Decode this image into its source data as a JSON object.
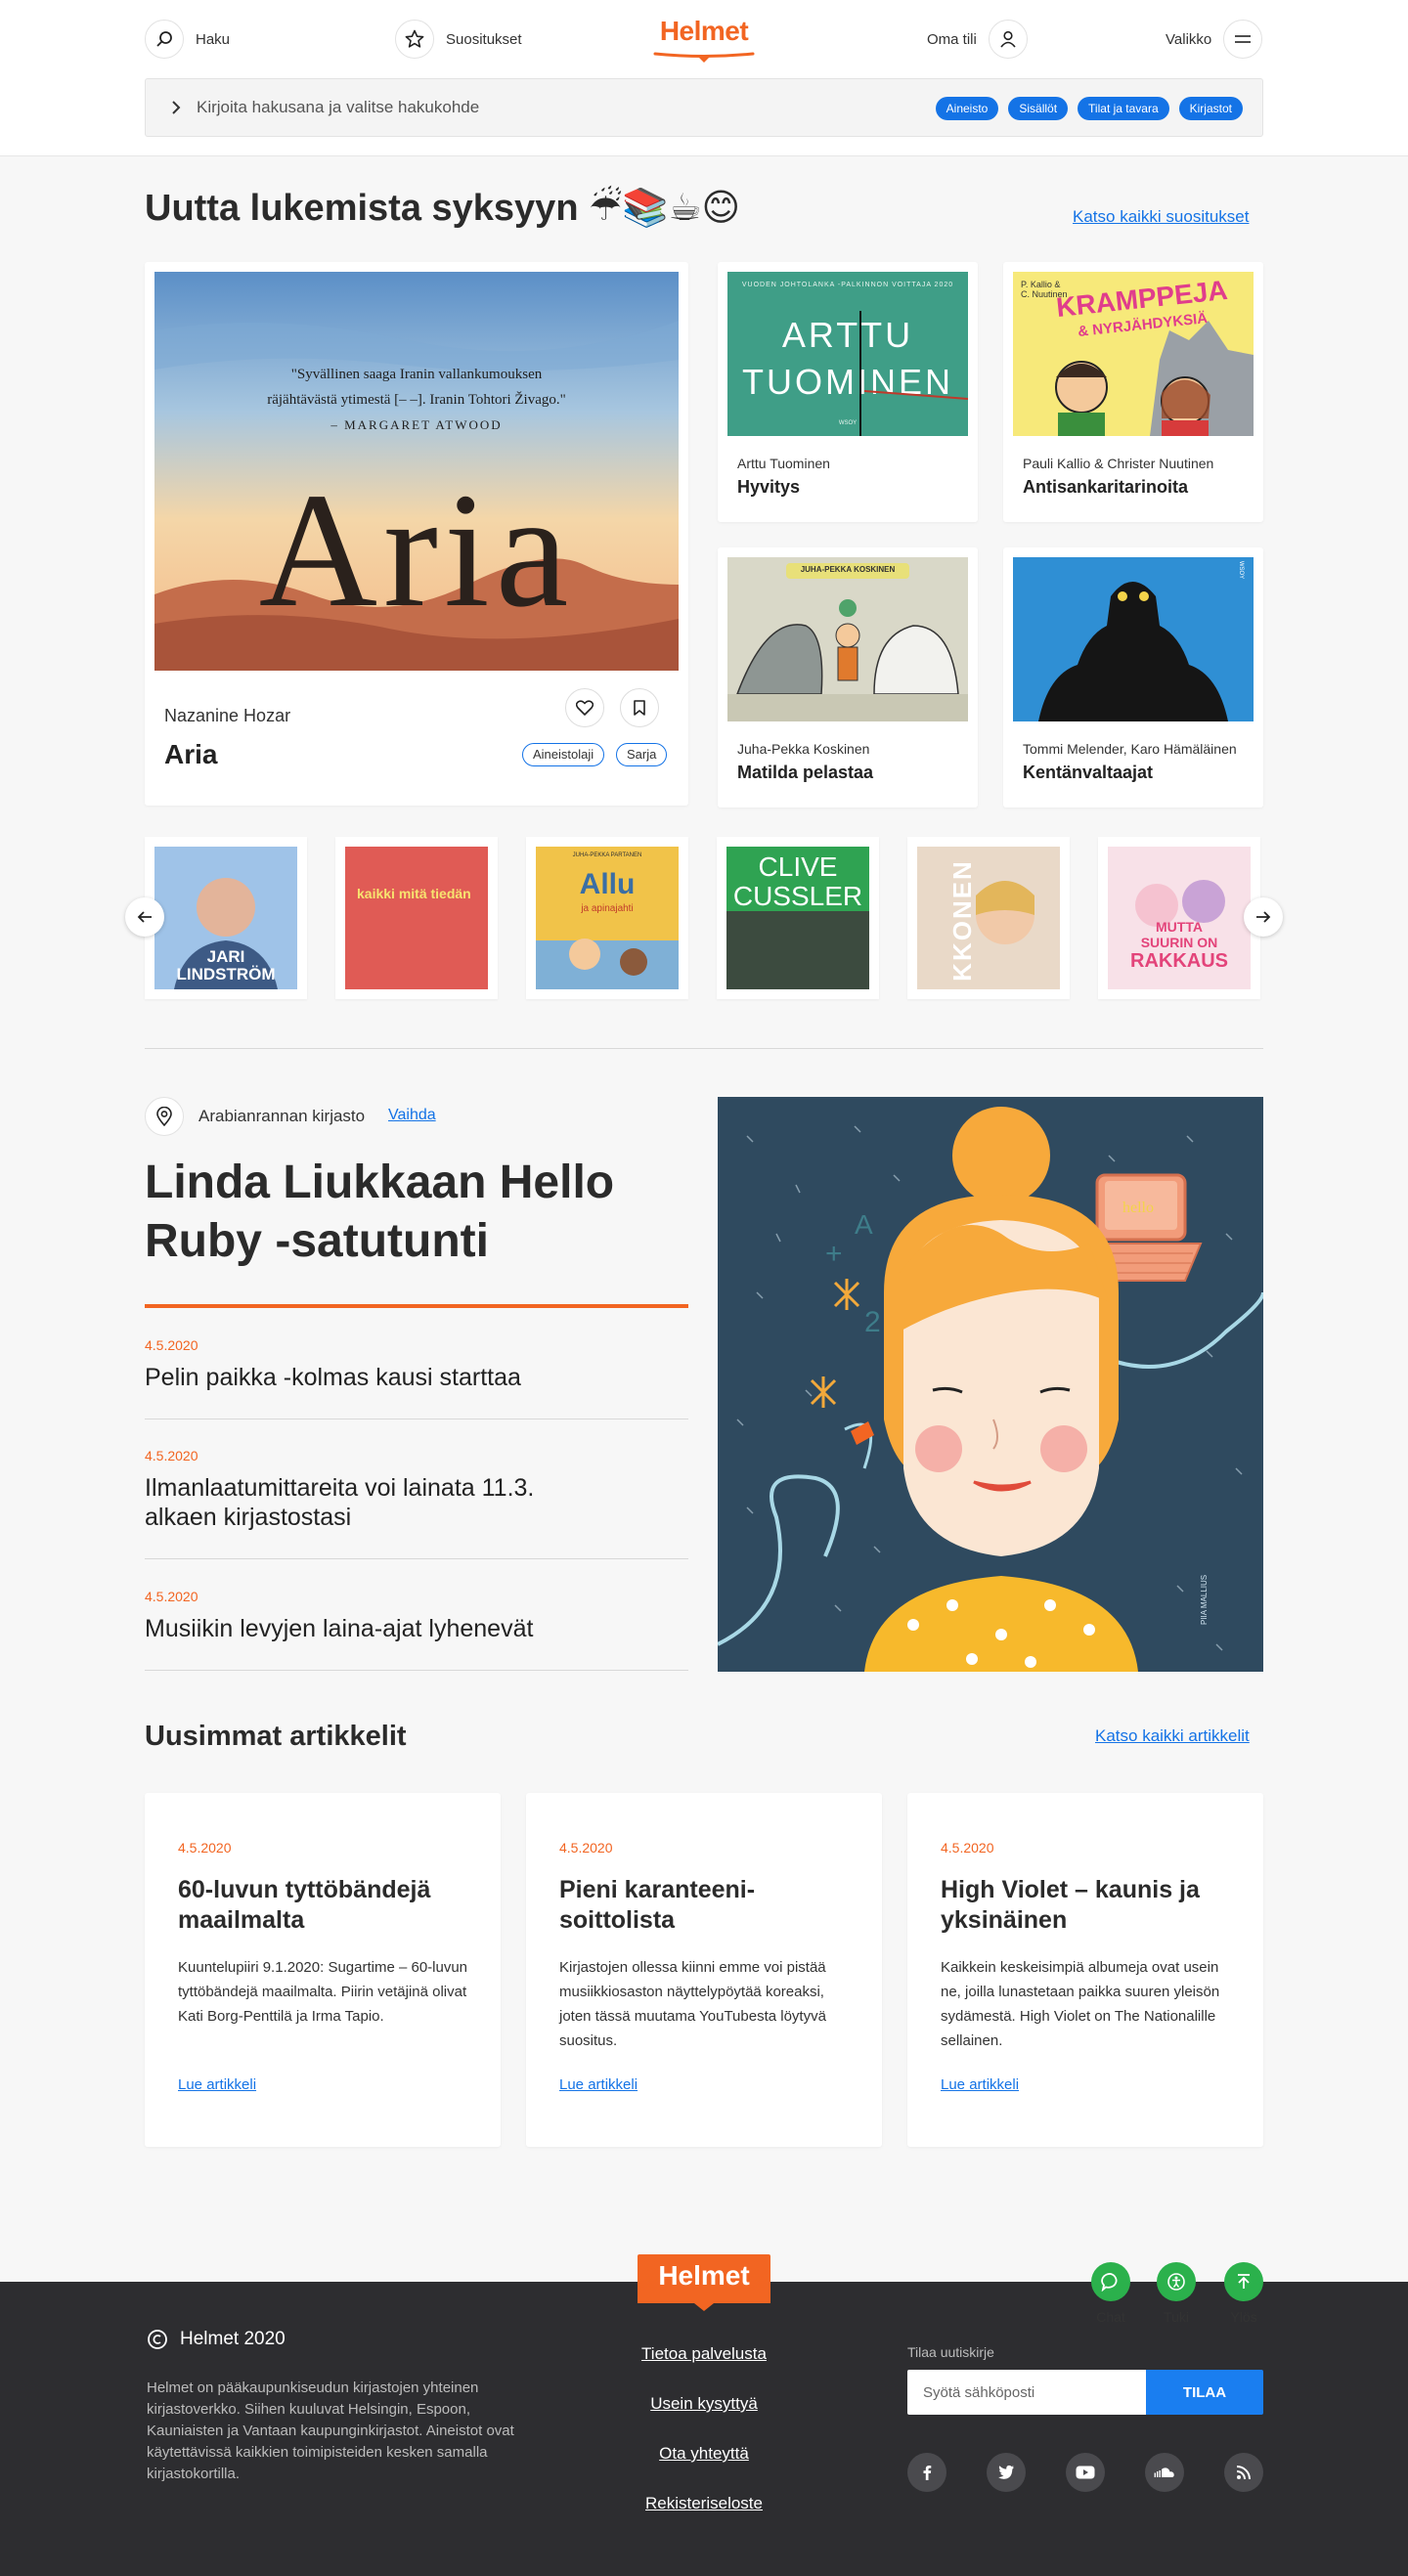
{
  "header": {
    "search_label": "Haku",
    "favorites_label": "Suositukset",
    "logo_text": "Helmet",
    "account_label": "Oma tili",
    "menu_label": "Valikko",
    "search_placeholder": "Kirjoita hakusana ja valitse hakukohde",
    "chips": [
      "Aineisto",
      "Sisällöt",
      "Tilat ja tavara",
      "Kirjastot"
    ]
  },
  "recommendations": {
    "title": "Uutta lukemista syksyyn ☔📚☕😊",
    "see_all": "Katso kaikki suositukset",
    "featured": {
      "cover_quote_line1": "\"Syvällinen saaga Iranin vallankumouksen",
      "cover_quote_line2": "räjähtävästä ytimestä [– –]. Iranin Tohtori Živago.\"",
      "cover_quote_author": "– MARGARET ATWOOD",
      "cover_title": "Aria",
      "author": "Nazanine Hozar",
      "title": "Aria",
      "tags": [
        "Aineistolaji",
        "Sarja"
      ]
    },
    "cards": [
      {
        "author": "Arttu Tuominen",
        "title": "Hyvitys",
        "cover_top": "VUODEN JOHTOLANKA -PALKINNON VOITTAJA 2020",
        "cover_line1": "ARTTU",
        "cover_line2": "TUOMINEN",
        "cover_publisher": "WSOY"
      },
      {
        "author": "Pauli Kallio & Christer Nuutinen",
        "title": "Antisankaritarinoita",
        "cover_small": "P. Kallio & C. Nuutinen",
        "cover_line1": "KRAMPPEJA",
        "cover_line2": "& NYRJÄHDYKSIÄ"
      },
      {
        "author": "Juha-Pekka Koskinen",
        "title": "Matilda pelastaa",
        "cover_banner": "JUHA-PEKKA KOSKINEN"
      },
      {
        "author": "Tommi Melender, Karo Hämäläinen",
        "title": "Kentänvaltaajat",
        "cover_publisher": "WSOY"
      }
    ],
    "carousel": {
      "thumb1": {
        "line1": "JARI",
        "line2": "LINDSTRÖM"
      },
      "thumb2": {
        "text": "kaikki mitä tiedän"
      },
      "thumb3": {
        "top": "JUHA-PEKKA PARTANEN",
        "title": "Allu",
        "subtitle": "ja apinajahti"
      },
      "thumb4": {
        "line1": "CLIVE",
        "line2": "CUSSLER"
      },
      "thumb5": {
        "text": "KKONEN"
      },
      "thumb6": {
        "line1": "MUTTA",
        "line2": "SUURIN ON",
        "line3": "RAKKAUS"
      }
    }
  },
  "library": {
    "name": "Arabianrannan kirjasto",
    "change_label": "Vaihda",
    "event_title": "Linda Liukkaan Hello Ruby -satutunti",
    "news": [
      {
        "date": "4.5.2020",
        "title": "Pelin paikka -kolmas kausi starttaa"
      },
      {
        "date": "4.5.2020",
        "title": "Ilmanlaatumittareita voi lainata 11.3. alkaen kirjastostasi"
      },
      {
        "date": "4.5.2020",
        "title": "Musiikin levyjen laina-ajat lyhenevät"
      }
    ],
    "image_laptop_text": "hello",
    "image_signature": "PIIA MALLIUS"
  },
  "articles": {
    "title": "Uusimmat artikkelit",
    "see_all": "Katso kaikki artikkelit",
    "items": [
      {
        "date": "4.5.2020",
        "title": "60-luvun tyttöbändejä maailmalta",
        "text": "Kuuntelupiiri 9.1.2020: Sugartime – 60-luvun tyttöbändejä maailmalta. Piirin vetäjinä olivat Kati Borg-Penttilä ja Irma Tapio.",
        "link": "Lue artikkeli"
      },
      {
        "date": "4.5.2020",
        "title": "Pieni karanteeni-soittolista",
        "text": "Kirjastojen ollessa kiinni emme voi pistää musiikkiosaston näyttelypöytää koreaksi, joten tässä muutama YouTubesta löytyvä suositus.",
        "link": "Lue artikkeli"
      },
      {
        "date": "4.5.2020",
        "title": "High Violet – kaunis ja yksinäinen",
        "text": "Kaikkein keskeisimpiä albumeja ovat usein ne, joilla lunastetaan paikka suuren yleisön sydämestä. High Violet on The Nationalille sellainen.",
        "link": "Lue artikkeli"
      }
    ]
  },
  "footer": {
    "logo_text": "Helmet",
    "copyright": "Helmet 2020",
    "about": "Helmet on pääkaupunkiseudun kirjastojen yhteinen kirjastoverkko. Siihen kuuluvat Helsingin, Espoon, Kauniaisten ja Vantaan kaupunginkirjastot. Aineistot ovat käytettävissä kaikkien toimipisteiden kesken samalla kirjastokortilla.",
    "links": [
      "Tietoa palvelusta",
      "Usein kysyttyä",
      "Ota yhteyttä",
      "Rekisteriseloste"
    ],
    "newsletter_label": "Tilaa uutiskirje",
    "email_placeholder": "Syötä sähköposti",
    "subscribe_label": "TILAA",
    "float_buttons": [
      "Chat",
      "Tuki",
      "Ylös"
    ]
  },
  "colors": {
    "brand_orange": "#f26522",
    "accent_blue": "#1473e6",
    "float_green": "#2bb14c",
    "footer_bg": "#2d2d30"
  }
}
